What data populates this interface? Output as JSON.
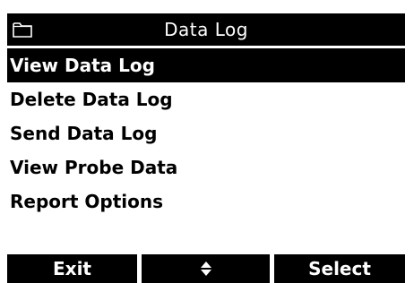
{
  "header": {
    "icon": "folder-icon",
    "title": "Data Log"
  },
  "menu": {
    "selected_index": 0,
    "items": [
      {
        "label": "View Data Log"
      },
      {
        "label": "Delete Data Log"
      },
      {
        "label": "Send Data Log"
      },
      {
        "label": "View Probe Data"
      },
      {
        "label": "Report Options"
      }
    ]
  },
  "softkeys": {
    "left_label": "Exit",
    "middle_icon": "up-down-arrow-icon",
    "right_label": "Select"
  },
  "colors": {
    "foreground": "#000000",
    "background": "#ffffff"
  }
}
